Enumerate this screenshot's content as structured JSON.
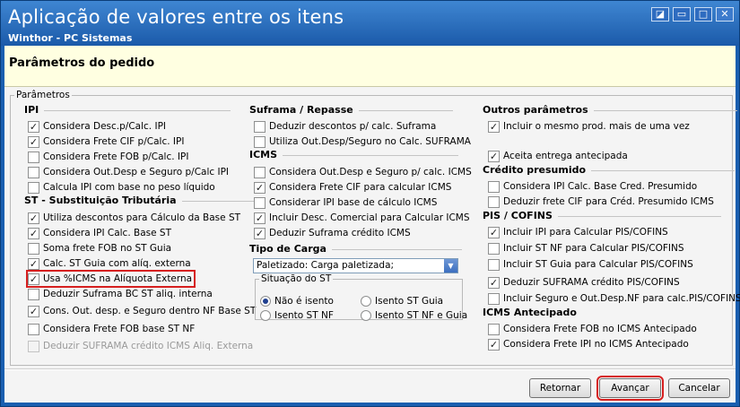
{
  "window": {
    "title": "Aplicação de valores entre os itens",
    "subtitle": "Winthor - PC Sistemas",
    "controls": [
      "◪",
      "▭",
      "□",
      "✕"
    ]
  },
  "header": {
    "title": "Parâmetros do pedido"
  },
  "params": {
    "legend": "Parâmetros",
    "ipi": {
      "title": "IPI",
      "items": [
        {
          "label": "Considera Desc.p/Calc. IPI",
          "checked": true
        },
        {
          "label": "Considera Frete CIF p/Calc. IPI",
          "checked": true
        },
        {
          "label": "Considera Frete FOB p/Calc. IPI",
          "checked": false
        },
        {
          "label": "Considera Out.Desp e Seguro p/Calc IPI",
          "checked": false
        },
        {
          "label": "Calcula IPI com base no peso líquido",
          "checked": false
        }
      ]
    },
    "st": {
      "title": "ST - Substituição Tributária",
      "items": [
        {
          "label": "Utiliza descontos para Cálculo da Base ST",
          "checked": true
        },
        {
          "label": "Considera IPI Calc. Base ST",
          "checked": true
        },
        {
          "label": "Soma frete FOB no ST Guia",
          "checked": false
        },
        {
          "label": "Calc. ST Guia com alíq. externa",
          "checked": true
        },
        {
          "label": "Usa %ICMS na Alíquota Externa",
          "checked": true
        },
        {
          "label": "Deduzir Suframa BC ST aliq. interna",
          "checked": false
        },
        {
          "label": "Cons. Out. desp. e Seguro dentro NF Base ST",
          "checked": true
        },
        {
          "label": "Considera Frete FOB base ST NF",
          "checked": false
        },
        {
          "label": "Deduzir SUFRAMA crédito ICMS Aliq. Externa",
          "checked": false
        }
      ]
    },
    "suframa": {
      "title": "Suframa / Repasse",
      "items": [
        {
          "label": "Deduzir descontos p/ calc. Suframa",
          "checked": false
        },
        {
          "label": "Utiliza Out.Desp/Seguro no Calc. SUFRAMA",
          "checked": false
        }
      ]
    },
    "icms": {
      "title": "ICMS",
      "items": [
        {
          "label": "Considera Out.Desp e Seguro p/ calc. ICMS",
          "checked": false
        },
        {
          "label": "Considera Frete CIF para calcular ICMS",
          "checked": true
        },
        {
          "label": "Considerar IPI base de cálculo ICMS",
          "checked": false
        },
        {
          "label": "Incluir Desc. Comercial  para Calcular ICMS",
          "checked": true
        },
        {
          "label": "Deduzir Suframa crédito ICMS",
          "checked": true
        }
      ]
    },
    "carga": {
      "title": "Tipo de Carga",
      "selected": "Paletizado: Carga paletizada;"
    },
    "situacao_st": {
      "legend": "Situação do ST",
      "options": [
        {
          "label": "Não é isento",
          "selected": true
        },
        {
          "label": "Isento ST Guia",
          "selected": false
        },
        {
          "label": "Isento ST NF",
          "selected": false
        },
        {
          "label": "Isento ST NF e Guia",
          "selected": false
        }
      ]
    },
    "outros": {
      "title": "Outros parâmetros",
      "items": [
        {
          "label": "Incluir o mesmo prod. mais de uma vez",
          "checked": true
        },
        {
          "label": "Aceita entrega antecipada",
          "checked": true
        }
      ]
    },
    "credito": {
      "title": "Crédito presumido",
      "items": [
        {
          "label": "Considera IPI Calc. Base Cred. Presumido",
          "checked": false
        },
        {
          "label": "Deduzir frete CIF para Créd. Presumido ICMS",
          "checked": false
        }
      ]
    },
    "pis": {
      "title": "PIS / COFINS",
      "items": [
        {
          "label": "Incluir IPI para Calcular PIS/COFINS",
          "checked": true
        },
        {
          "label": "Incluir ST NF para Calcular PIS/COFINS",
          "checked": false
        },
        {
          "label": "Incluir ST Guia para Calcular PIS/COFINS",
          "checked": false
        },
        {
          "label": "Deduzir SUFRAMA crédito PIS/COFINS",
          "checked": true
        },
        {
          "label": "Incluir Seguro e Out.Desp.NF para calc.PIS/COFINS",
          "checked": false
        }
      ]
    },
    "icms_antecipado": {
      "title": "ICMS Antecipado",
      "items": [
        {
          "label": "Considera Frete FOB no ICMS Antecipado",
          "checked": false
        },
        {
          "label": "Considera Frete IPI no ICMS Antecipado",
          "checked": true
        }
      ]
    }
  },
  "footer": {
    "retornar": "Retornar",
    "avancar": "Avançar",
    "cancelar": "Cancelar"
  }
}
